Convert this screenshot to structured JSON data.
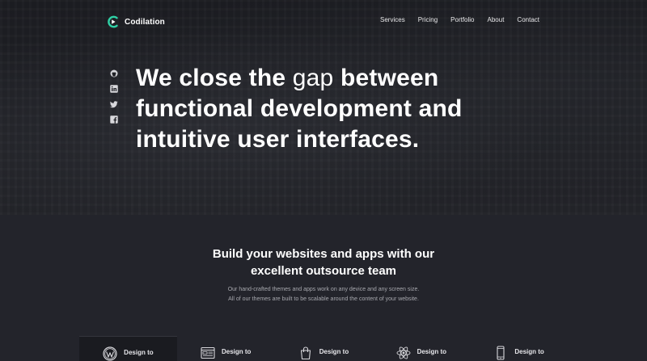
{
  "brand": {
    "name": "Codilation",
    "accent": "#2fd1a6"
  },
  "nav": {
    "items": [
      {
        "label": "Services"
      },
      {
        "label": "Pricing"
      },
      {
        "label": "Portfolio"
      },
      {
        "label": "About"
      },
      {
        "label": "Contact"
      }
    ]
  },
  "social": [
    "github-icon",
    "linkedin-icon",
    "twitter-icon",
    "facebook-icon"
  ],
  "hero": {
    "line1_a": "We close the ",
    "line1_light": "gap",
    "line1_b": " between",
    "line2": "functional development and",
    "line3": "intuitive user interfaces."
  },
  "section": {
    "title_line1": "Build your websites and apps with our",
    "title_line2": "excellent outsource team",
    "sub_line1": "Our hand-crafted themes and apps work on any device and any screen size.",
    "sub_line2": "All of our themes are built to be scalable around the content of your website."
  },
  "tabs": [
    {
      "label": "Design to",
      "icon": "wordpress-icon",
      "active": true
    },
    {
      "label": "Design to",
      "icon": "browser-window-icon",
      "active": false
    },
    {
      "label": "Design to",
      "icon": "shopping-bag-icon",
      "active": false
    },
    {
      "label": "Design to",
      "icon": "react-atom-icon",
      "active": false
    },
    {
      "label": "Design to",
      "icon": "mobile-phone-icon",
      "active": false
    }
  ]
}
